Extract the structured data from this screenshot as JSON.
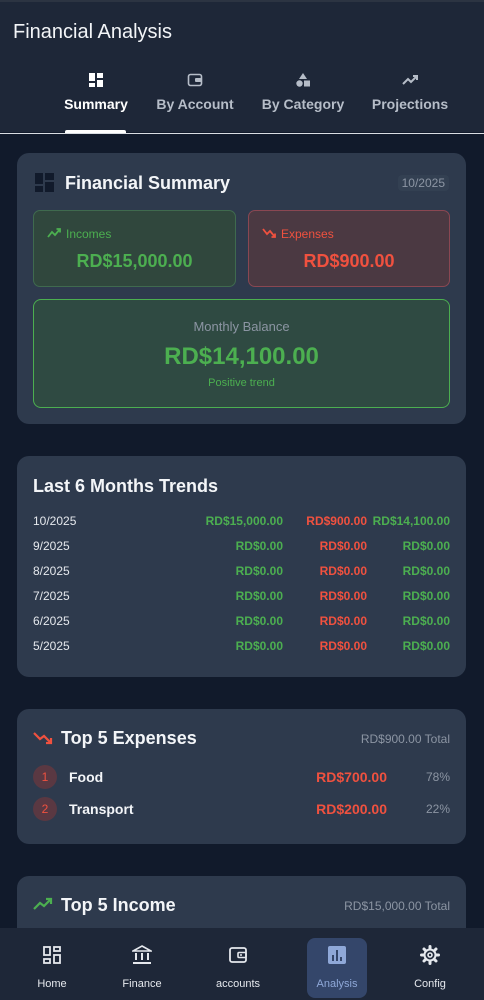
{
  "app": {
    "title": "Financial Analysis"
  },
  "tabs": [
    {
      "label": "Summary",
      "icon": "dashboard-icon",
      "active": true
    },
    {
      "label": "By Account",
      "icon": "wallet-icon",
      "active": false
    },
    {
      "label": "By Category",
      "icon": "category-icon",
      "active": false
    },
    {
      "label": "Projections",
      "icon": "trending-up-icon",
      "active": false
    }
  ],
  "summary": {
    "title": "Financial Summary",
    "period": "10/2025",
    "incomes_label": "Incomes",
    "incomes_value": "RD$15,000.00",
    "expenses_label": "Expenses",
    "expenses_value": "RD$900.00",
    "balance_label": "Monthly Balance",
    "balance_value": "RD$14,100.00",
    "balance_trend": "Positive trend"
  },
  "trends": {
    "title": "Last 6 Months Trends",
    "rows": [
      {
        "month": "10/2025",
        "income": "RD$15,000.00",
        "expense": "RD$900.00",
        "balance": "RD$14,100.00"
      },
      {
        "month": "9/2025",
        "income": "RD$0.00",
        "expense": "RD$0.00",
        "balance": "RD$0.00"
      },
      {
        "month": "8/2025",
        "income": "RD$0.00",
        "expense": "RD$0.00",
        "balance": "RD$0.00"
      },
      {
        "month": "7/2025",
        "income": "RD$0.00",
        "expense": "RD$0.00",
        "balance": "RD$0.00"
      },
      {
        "month": "6/2025",
        "income": "RD$0.00",
        "expense": "RD$0.00",
        "balance": "RD$0.00"
      },
      {
        "month": "5/2025",
        "income": "RD$0.00",
        "expense": "RD$0.00",
        "balance": "RD$0.00"
      }
    ]
  },
  "top_expenses": {
    "title": "Top 5 Expenses",
    "total": "RD$900.00 Total",
    "items": [
      {
        "rank": "1",
        "name": "Food",
        "amount": "RD$700.00",
        "percent": "78%"
      },
      {
        "rank": "2",
        "name": "Transport",
        "amount": "RD$200.00",
        "percent": "22%"
      }
    ]
  },
  "top_income": {
    "title": "Top 5 Income",
    "total": "RD$15,000.00 Total"
  },
  "bottom_nav": [
    {
      "label": "Home",
      "icon": "home-grid-icon",
      "active": false
    },
    {
      "label": "Finance",
      "icon": "bank-icon",
      "active": false
    },
    {
      "label": "accounts",
      "icon": "wallet-icon",
      "active": false
    },
    {
      "label": "Analysis",
      "icon": "analytics-icon",
      "active": true
    },
    {
      "label": "Config",
      "icon": "gear-icon",
      "active": false
    }
  ],
  "colors": {
    "background": "#111a2b",
    "card": "#2e3a4d",
    "income": "#4caf50",
    "expense": "#f0513f",
    "nav_active": "#34466a"
  }
}
